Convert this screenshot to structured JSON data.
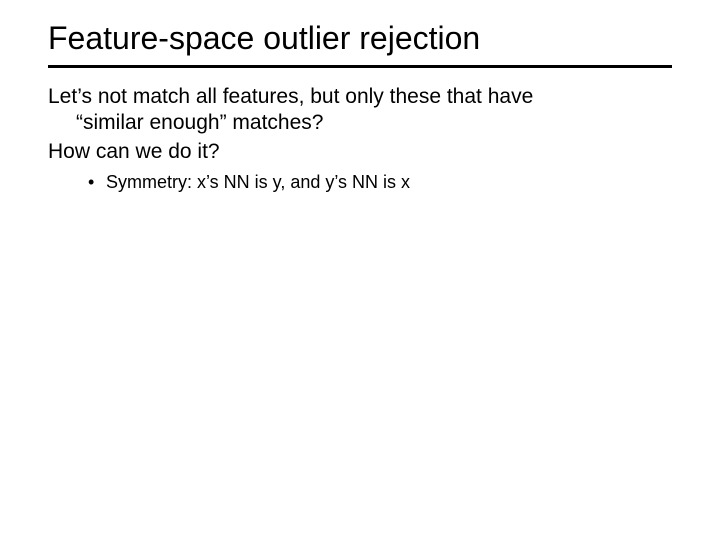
{
  "title": "Feature-space outlier rejection",
  "body": {
    "line1a": "Let’s not match all features, but only these that have",
    "line1b": "“similar enough” matches?",
    "line2": "How can we do it?"
  },
  "bullets": [
    {
      "marker": "•",
      "text": "Symmetry: x’s NN is y, and y’s NN is x"
    }
  ]
}
